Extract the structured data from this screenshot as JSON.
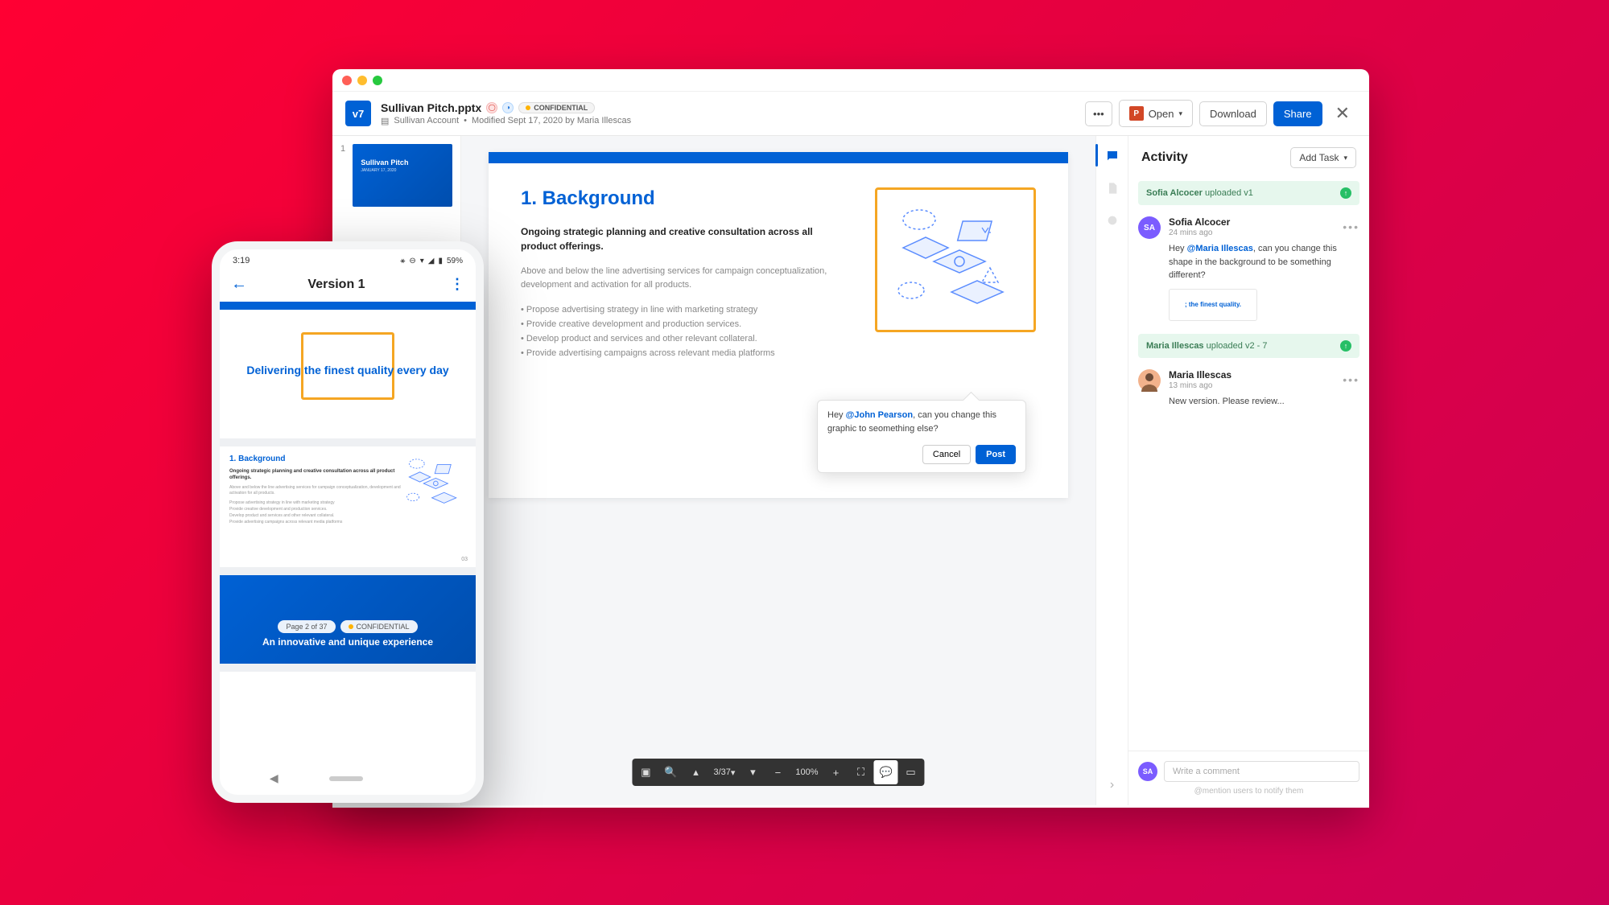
{
  "window": {
    "header": {
      "version_badge": "v7",
      "title": "Sullivan Pitch.pptx",
      "confidential": "CONFIDENTIAL",
      "folder": "Sullivan Account",
      "modified": "Modified Sept 17, 2020 by Maria Illescas"
    },
    "actions": {
      "open": "Open",
      "download": "Download",
      "share": "Share"
    },
    "thumb": {
      "num": "1",
      "title": "Sullivan Pitch"
    },
    "slide": {
      "heading": "1. Background",
      "lead": "Ongoing strategic planning and creative consultation across all product offerings.",
      "para": "Above and below the line advertising services for campaign conceptualization, development and activation for all products.",
      "bullets": [
        "Propose advertising strategy in line with marketing strategy",
        "Provide creative development and production services.",
        "Develop product and services and other relevant collateral.",
        "Provide advertising campaigns across relevant media platforms"
      ]
    },
    "popover": {
      "prefix": "Hey ",
      "mention": "@John Pearson",
      "suffix": ", can you change this graphic to seomething else?",
      "cancel": "Cancel",
      "post": "Post"
    },
    "toolbar": {
      "pages": "3/37",
      "zoom": "100%"
    },
    "activity": {
      "title": "Activity",
      "add_task": "Add Task",
      "sys1_name": "Sofia Alcocer",
      "sys1_action": " uploaded v1",
      "c1_name": "Sofia Alcocer",
      "c1_time": "24 mins ago",
      "c1_prefix": "Hey ",
      "c1_mention": "@Maria Illescas",
      "c1_suffix": ", can you change this shape in the background to be something different?",
      "c1_thumb": "; the finest quality.",
      "sys2_name": "Maria Illescas",
      "sys2_action": " uploaded v2 - 7",
      "c2_name": "Maria Illescas",
      "c2_time": "13 mins ago",
      "c2_text": "New version. Please review...",
      "input_placeholder": "Write a comment",
      "mention_hint": "@mention users to notify them"
    }
  },
  "phone": {
    "status": {
      "time": "3:19",
      "battery": "59%"
    },
    "appbar": {
      "title": "Version 1"
    },
    "slide1": {
      "prefix": "Delivering ",
      "highlight": "the finest quality",
      "suffix": " every day"
    },
    "slide2": {
      "heading": "1. Background",
      "lead": "Ongoing strategic planning and creative consultation across all product offerings.",
      "para": "Above and below the line advertising services for campaign conceptualization, development and activation for all products.",
      "bullets": [
        "Propose advertising strategy in line with marketing strategy",
        "Provide creative development and production services.",
        "Develop product and services and other relevant collateral.",
        "Provide advertising campaigns across relevant media platforms"
      ],
      "page": "03"
    },
    "slide3": {
      "text": "An innovative and unique experience"
    },
    "pills": {
      "page": "Page 2 of 37",
      "confidential": "CONFIDENTIAL"
    }
  }
}
